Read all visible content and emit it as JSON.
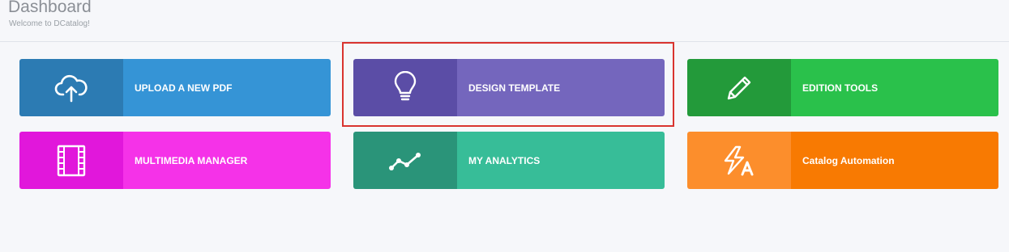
{
  "header": {
    "title": "Dashboard",
    "subtitle": "Welcome to DCatalog!"
  },
  "tiles": [
    {
      "label": "UPLOAD A NEW PDF",
      "icon": "cloud-upload-icon",
      "dark": "#2c7bb3",
      "light": "#3594d6"
    },
    {
      "label": "DESIGN TEMPLATE",
      "icon": "lightbulb-icon",
      "dark": "#5b4da6",
      "light": "#7466bd"
    },
    {
      "label": "EDITION TOOLS",
      "icon": "pencil-icon",
      "dark": "#239a3a",
      "light": "#2ac14b"
    },
    {
      "label": "MULTIMEDIA MANAGER",
      "icon": "film-icon",
      "dark": "#e117db",
      "light": "#f532e8"
    },
    {
      "label": "MY ANALYTICS",
      "icon": "analytics-line-icon",
      "dark": "#2a9479",
      "light": "#37bd98"
    },
    {
      "label": "Catalog Automation",
      "icon": "automation-bolt-icon",
      "dark": "#fc8e2c",
      "light": "#f87a02"
    }
  ],
  "selection": {
    "color": "#d9342f",
    "selected": "DESIGN TEMPLATE"
  }
}
